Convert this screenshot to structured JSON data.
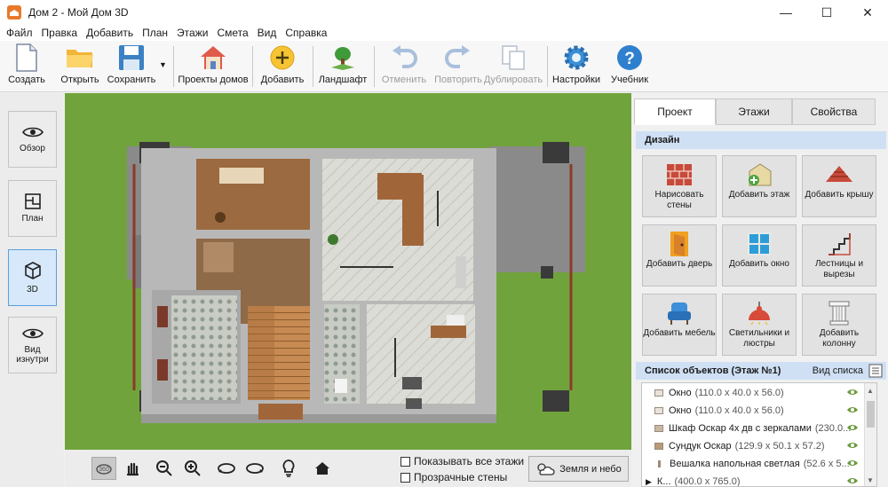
{
  "window": {
    "title": "Дом 2 - Мой Дом 3D"
  },
  "menu": [
    "Файл",
    "Правка",
    "Добавить",
    "План",
    "Этажи",
    "Смета",
    "Вид",
    "Справка"
  ],
  "toolbar": {
    "create": "Создать",
    "open": "Открыть",
    "save": "Сохранить",
    "projects": "Проекты домов",
    "add": "Добавить",
    "landscape": "Ландшафт",
    "undo": "Отменить",
    "redo": "Повторить",
    "duplicate": "Дублировать",
    "settings": "Настройки",
    "tutorial": "Учебник"
  },
  "views": {
    "overview": "Обзор",
    "plan": "План",
    "view3d": "3D",
    "inside": "Вид изнутри"
  },
  "bottom": {
    "show_all_floors": "Показывать все этажи",
    "transparent_walls": "Прозрачные стены",
    "earth_sky": "Земля и небо"
  },
  "rightpanel": {
    "tabs": [
      "Проект",
      "Этажи",
      "Свойства"
    ],
    "design_title": "Дизайн",
    "design_buttons": [
      "Нарисовать стены",
      "Добавить этаж",
      "Добавить крышу",
      "Добавить дверь",
      "Добавить окно",
      "Лестницы и вырезы",
      "Добавить мебель",
      "Светильники и люстры",
      "Добавить колонну"
    ],
    "objlist_title": "Список объектов (Этаж №1)",
    "objlist_view": "Вид списка",
    "objects": [
      {
        "name": "Окно",
        "dims": "(110.0 x 40.0 x 56.0)"
      },
      {
        "name": "Окно",
        "dims": "(110.0 x 40.0 x 56.0)"
      },
      {
        "name": "Шкаф Оскар 4х дв с зеркалами",
        "dims": "(230.0..."
      },
      {
        "name": "Сундук Оскар",
        "dims": "(129.9 x 50.1 x 57.2)"
      },
      {
        "name": "Вешалка напольная светлая",
        "dims": "(52.6 x 5..."
      },
      {
        "name": "К...",
        "dims": "(400.0 x 765.0)"
      }
    ]
  },
  "colors": {
    "accent": "#d6e8fa",
    "section": "#cfe0f4",
    "grass": "#71a33c"
  }
}
